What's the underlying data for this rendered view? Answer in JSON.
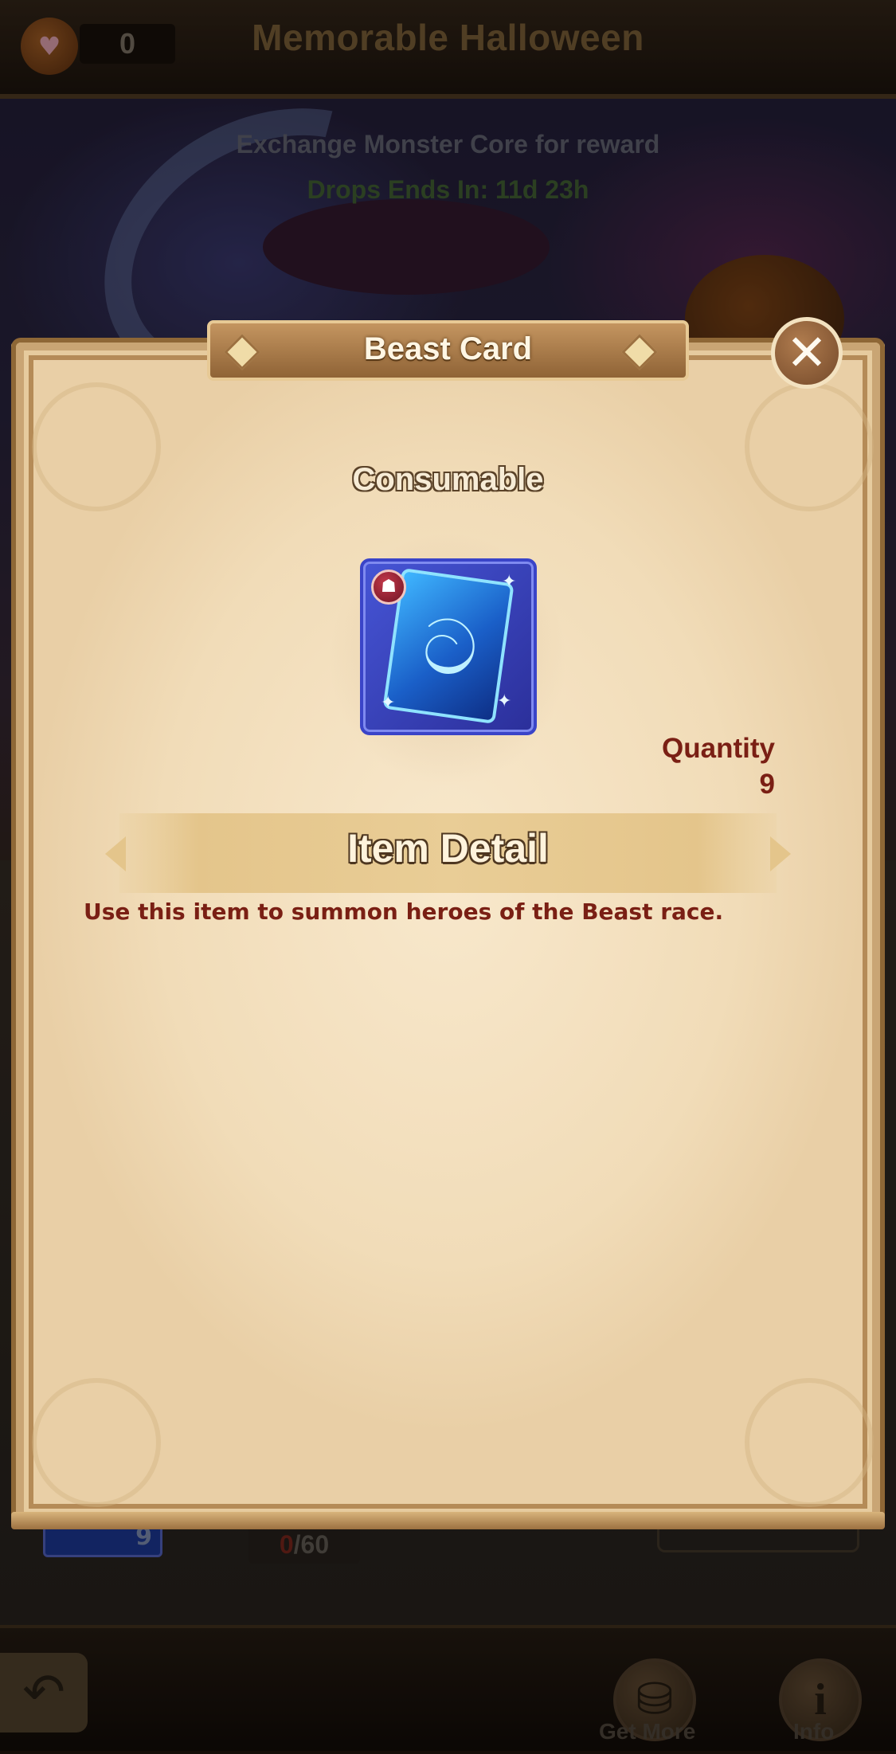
{
  "header": {
    "title": "Memorable Halloween",
    "currency_count": "0"
  },
  "event": {
    "exchange_text": "Exchange Monster Core for reward",
    "drops_text": "Drops Ends In: 11d 23h"
  },
  "background_list": {
    "card_count": "9",
    "progress_current": "0",
    "progress_total": "/60"
  },
  "modal": {
    "title": "Beast Card",
    "category": "Consumable",
    "quantity_label": "Quantity",
    "quantity_value": "9",
    "detail_heading": "Item Detail",
    "description": "Use this item to summon heroes of the Beast race.",
    "item_icon": "beast-card-icon",
    "race_icon": "beast-race-icon"
  },
  "bottom_bar": {
    "get_more_label": "Get More",
    "info_label": "Info"
  },
  "colors": {
    "modal_bg": "#f4e2c2",
    "accent_text": "#7a1f14",
    "frame": "#c9a574",
    "item_frame": "#3a44c8"
  }
}
